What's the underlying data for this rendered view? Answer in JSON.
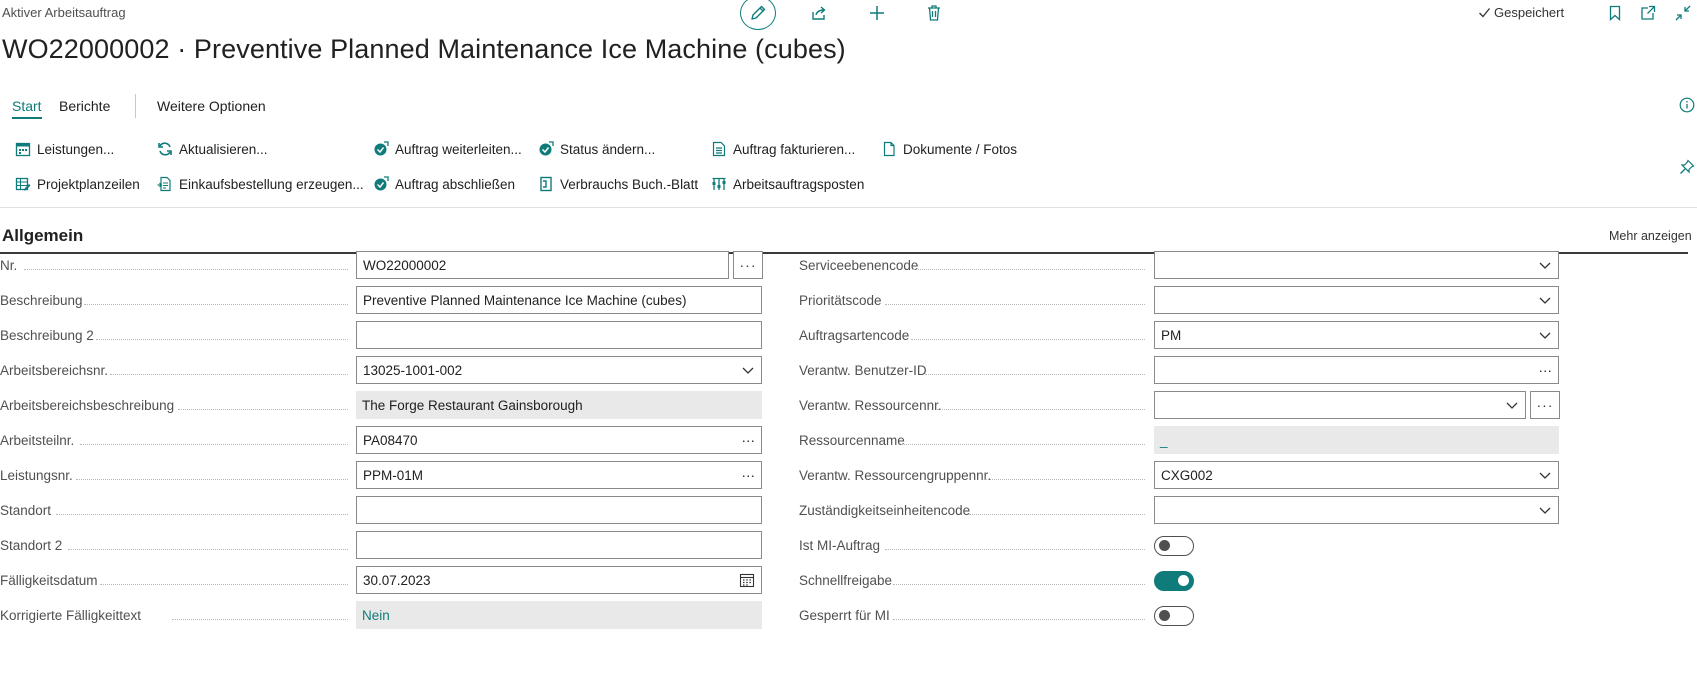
{
  "header": {
    "caption": "Aktiver Arbeitsauftrag",
    "title": "WO22000002 · Preventive Planned Maintenance Ice Machine (cubes)",
    "saved_status": "Gespeichert"
  },
  "tabs": [
    {
      "label": "Start",
      "active": true
    },
    {
      "label": "Berichte"
    },
    {
      "label": "Weitere Optionen"
    }
  ],
  "actions": [
    {
      "label": "Leistungen...",
      "icon": "calendar-icon"
    },
    {
      "label": "Projektplanzeilen",
      "icon": "list-edit-icon"
    },
    {
      "label": "Aktualisieren...",
      "icon": "refresh-icon"
    },
    {
      "label": "Einkaufsbestellung erzeugen...",
      "icon": "document-arrow-icon"
    },
    {
      "label": "Auftrag weiterleiten...",
      "icon": "approve-icon"
    },
    {
      "label": "Auftrag abschließen",
      "icon": "approve-icon"
    },
    {
      "label": "Status ändern...",
      "icon": "approve-icon"
    },
    {
      "label": "Verbrauchs Buch.-Blatt",
      "icon": "journal-icon"
    },
    {
      "label": "Auftrag fakturieren...",
      "icon": "invoice-icon"
    },
    {
      "label": "Arbeitsauftragsposten",
      "icon": "entries-icon"
    },
    {
      "label": "Dokumente / Fotos",
      "icon": "document-icon"
    }
  ],
  "section": {
    "title": "Allgemein",
    "more_label": "Mehr anzeigen"
  },
  "left_fields": [
    {
      "label": "Nr.",
      "value": "WO22000002"
    },
    {
      "label": "Beschreibung",
      "value": "Preventive Planned Maintenance Ice Machine (cubes)"
    },
    {
      "label": "Beschreibung 2",
      "value": ""
    },
    {
      "label": "Arbeitsbereichsnr.",
      "value": "13025-1001-002"
    },
    {
      "label": "Arbeitsbereichsbeschreibung",
      "value": "The Forge Restaurant Gainsborough"
    },
    {
      "label": "Arbeitsteilnr.",
      "value": "PA08470"
    },
    {
      "label": "Leistungsnr.",
      "value": "PPM-01M"
    },
    {
      "label": "Standort",
      "value": ""
    },
    {
      "label": "Standort 2",
      "value": ""
    },
    {
      "label": "Fälligkeitsdatum",
      "value": "30.07.2023"
    },
    {
      "label": "Korrigierte Fälligkeittext",
      "value": "Nein"
    }
  ],
  "right_fields": [
    {
      "label": "Serviceebenencode",
      "value": ""
    },
    {
      "label": "Prioritätscode",
      "value": ""
    },
    {
      "label": "Auftragsartencode",
      "value": "PM"
    },
    {
      "label": "Verantw. Benutzer-ID",
      "value": ""
    },
    {
      "label": "Verantw. Ressourcennr.",
      "value": ""
    },
    {
      "label": "Ressourcenname",
      "value": "_"
    },
    {
      "label": "Verantw. Ressourcengruppennr.",
      "value": "CXG002"
    },
    {
      "label": "Zuständigkeitseinheitencode",
      "value": ""
    },
    {
      "label": "Ist MI-Auftrag",
      "checked": false
    },
    {
      "label": "Schnellfreigabe",
      "checked": true
    },
    {
      "label": "Gesperrt für MI",
      "checked": false
    }
  ],
  "colors": {
    "accent": "#0f7b7b",
    "readonly_bg": "#e9e9e9"
  }
}
